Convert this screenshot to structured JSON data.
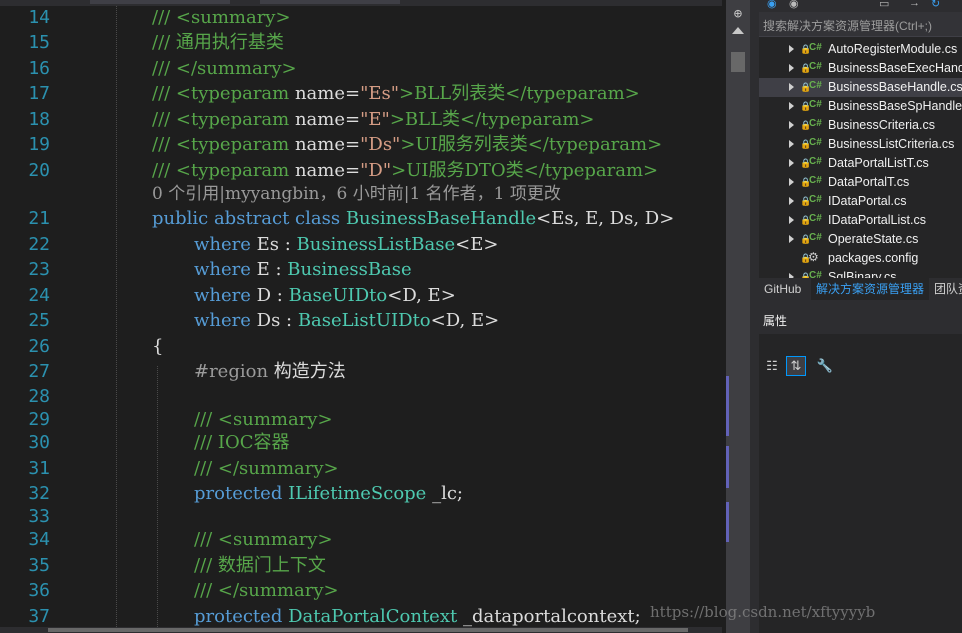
{
  "editor": {
    "lines": [
      {
        "num": "14",
        "segs": [
          [
            "cm",
            "/// <summary>"
          ]
        ]
      },
      {
        "num": "15",
        "segs": [
          [
            "cm",
            "/// 通用执行基类"
          ]
        ]
      },
      {
        "num": "16",
        "segs": [
          [
            "cm",
            "/// </summary>"
          ]
        ]
      },
      {
        "num": "17",
        "segs": [
          [
            "cm",
            "/// <typeparam "
          ],
          [
            "tx",
            "name="
          ],
          [
            "str",
            "\"Es\""
          ],
          [
            "cm",
            ">BLL列表类</typeparam>"
          ]
        ]
      },
      {
        "num": "18",
        "segs": [
          [
            "cm",
            "/// <typeparam "
          ],
          [
            "tx",
            "name="
          ],
          [
            "str",
            "\"E\""
          ],
          [
            "cm",
            ">BLL类</typeparam>"
          ]
        ]
      },
      {
        "num": "19",
        "segs": [
          [
            "cm",
            "/// <typeparam "
          ],
          [
            "tx",
            "name="
          ],
          [
            "str",
            "\"Ds\""
          ],
          [
            "cm",
            ">UI服务列表类</typeparam>"
          ]
        ]
      },
      {
        "num": "20",
        "segs": [
          [
            "cm",
            "/// <typeparam "
          ],
          [
            "tx",
            "name="
          ],
          [
            "str",
            "\"D\""
          ],
          [
            "cm",
            ">UI服务DTO类</typeparam>"
          ]
        ]
      },
      {
        "num": "21",
        "segs": [
          [
            "kw",
            "public abstract class "
          ],
          [
            "ty",
            "BusinessBaseHandle"
          ],
          [
            "tx",
            "<Es, E, Ds, D>"
          ]
        ]
      },
      {
        "num": "22",
        "segs": [
          [
            "kw",
            "where "
          ],
          [
            "tx",
            "Es : "
          ],
          [
            "ty",
            "BusinessListBase"
          ],
          [
            "tx",
            "<E>"
          ]
        ]
      },
      {
        "num": "23",
        "segs": [
          [
            "kw",
            "where "
          ],
          [
            "tx",
            "E : "
          ],
          [
            "ty",
            "BusinessBase"
          ]
        ]
      },
      {
        "num": "24",
        "segs": [
          [
            "kw",
            "where "
          ],
          [
            "tx",
            "D : "
          ],
          [
            "ty",
            "BaseUIDto"
          ],
          [
            "tx",
            "<D, E>"
          ]
        ]
      },
      {
        "num": "25",
        "segs": [
          [
            "kw",
            "where "
          ],
          [
            "tx",
            "Ds : "
          ],
          [
            "ty",
            "BaseListUIDto"
          ],
          [
            "tx",
            "<D, E>"
          ]
        ]
      },
      {
        "num": "26",
        "segs": [
          [
            "tx",
            "{"
          ]
        ]
      },
      {
        "num": "27",
        "segs": [
          [
            "pp",
            "#region "
          ],
          [
            "tx",
            "构造方法"
          ]
        ]
      },
      {
        "num": "28",
        "segs": []
      },
      {
        "num": "29",
        "segs": [
          [
            "cm",
            "/// <summary>"
          ]
        ]
      },
      {
        "num": "30",
        "segs": [
          [
            "cm",
            "/// IOC容器"
          ]
        ]
      },
      {
        "num": "31",
        "segs": [
          [
            "cm",
            "/// </summary>"
          ]
        ]
      },
      {
        "num": "32",
        "segs": [
          [
            "kw",
            "protected "
          ],
          [
            "ty",
            "ILifetimeScope"
          ],
          [
            "tx",
            " _lc;"
          ]
        ]
      },
      {
        "num": "33",
        "segs": []
      },
      {
        "num": "34",
        "segs": [
          [
            "cm",
            "/// <summary>"
          ]
        ]
      },
      {
        "num": "35",
        "segs": [
          [
            "cm",
            "/// 数据门上下文"
          ]
        ]
      },
      {
        "num": "36",
        "segs": [
          [
            "cm",
            "/// </summary>"
          ]
        ]
      },
      {
        "num": "37",
        "segs": [
          [
            "kw",
            "protected "
          ],
          [
            "ty",
            "DataPortalContext"
          ],
          [
            "tx",
            " _dataportalcontext;"
          ]
        ]
      }
    ],
    "codelens": "0 个引用|myyangbin，6 小时前|1 名作者，1 项更改"
  },
  "solution_explorer": {
    "search_placeholder": "搜索解决方案资源管理器(Ctrl+;)",
    "items": [
      {
        "label": "AutoRegisterModule.cs",
        "icon": "csharp-file-icon",
        "selected": false
      },
      {
        "label": "BusinessBaseExecHandle.cs",
        "icon": "csharp-file-icon",
        "selected": false
      },
      {
        "label": "BusinessBaseHandle.cs",
        "icon": "csharp-file-icon",
        "selected": true
      },
      {
        "label": "BusinessBaseSpHandle.cs",
        "icon": "csharp-file-icon",
        "selected": false
      },
      {
        "label": "BusinessCriteria.cs",
        "icon": "csharp-file-icon",
        "selected": false
      },
      {
        "label": "BusinessListCriteria.cs",
        "icon": "csharp-file-icon",
        "selected": false
      },
      {
        "label": "DataPortalListT.cs",
        "icon": "csharp-file-icon",
        "selected": false
      },
      {
        "label": "DataPortalT.cs",
        "icon": "csharp-file-icon",
        "selected": false
      },
      {
        "label": "IDataPortal.cs",
        "icon": "csharp-file-icon",
        "selected": false
      },
      {
        "label": "IDataPortalList.cs",
        "icon": "csharp-file-icon",
        "selected": false
      },
      {
        "label": "OperateState.cs",
        "icon": "csharp-file-icon",
        "selected": false
      },
      {
        "label": "packages.config",
        "icon": "config-file-icon",
        "selected": false
      },
      {
        "label": "SqlBinary.cs",
        "icon": "csharp-file-icon",
        "selected": false
      }
    ],
    "csharp_badge": "C#",
    "tabs": [
      "GitHub",
      "解决方案资源管理器",
      "团队资源管理器"
    ]
  },
  "properties": {
    "title": "属性",
    "buttons": [
      {
        "name": "categorized-icon",
        "glyph": "☷",
        "active": false
      },
      {
        "name": "alphabetical-icon",
        "glyph": "⇅",
        "active": true
      },
      {
        "name": "property-pages-icon",
        "glyph": "🔧",
        "active": false
      }
    ]
  },
  "watermark": "https://blog.csdn.net/xftyyyyb",
  "colors": {
    "comment": "#57a64a",
    "keyword": "#569cd6",
    "type": "#4ec9b0",
    "string": "#d69d85",
    "text": "#dcdcdc",
    "line_number": "#2b91af",
    "active_tab": "#3aa0f2",
    "change_marker": "#6262b8"
  }
}
